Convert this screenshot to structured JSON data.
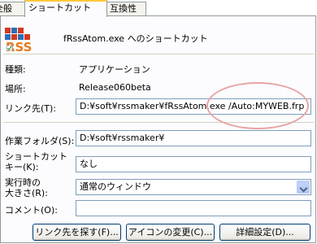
{
  "tabs": [
    "全般",
    "ショートカット",
    "互換性"
  ],
  "header": {
    "title": "fRssAtom.exe へのショートカット"
  },
  "rows": {
    "type_label": "種類:",
    "type_value": "アプリケーション",
    "location_label": "場所:",
    "location_value": "Release060beta",
    "target_label": "リンク先(T):",
    "target_value": "D:¥soft¥rssmaker¥fRssAtom.exe /Auto:MYWEB.frp",
    "startin_label": "作業フォルダ(S):",
    "startin_value": "D:¥soft¥rssmaker¥",
    "shortcut_label_1": "ショートカット",
    "shortcut_label_2": "キー(K):",
    "shortcut_value": "なし",
    "run_label_1": "実行時の",
    "run_label_2": "大きさ(R):",
    "run_value": "通常のウィンドウ",
    "comment_label": "コメント(O):",
    "comment_value": ""
  },
  "buttons": {
    "find_target": "リンク先を探す(F)...",
    "change_icon": "アイコンの変更(C)...",
    "advanced": "詳細設定(D)..."
  },
  "colors": {
    "highlight_ellipse": "#e8a4a4",
    "tab_hot": "#ffc83c"
  }
}
